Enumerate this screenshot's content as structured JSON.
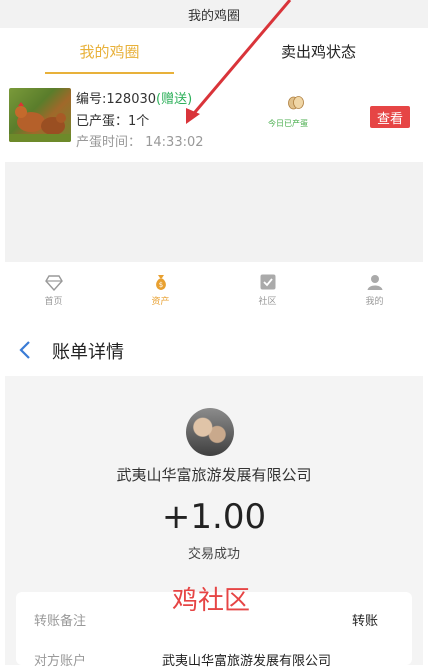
{
  "top": {
    "title": "我的鸡圈",
    "tabs": [
      {
        "label": "我的鸡圈",
        "active": true
      },
      {
        "label": "卖出鸡状态",
        "active": false
      }
    ]
  },
  "chicken_card": {
    "number": "编号:128030",
    "gift": "(赠送)",
    "eggs_laid": "已产蛋：1个",
    "lay_time": "产蛋时间：  14:33:02",
    "today_label": "今日已产蛋",
    "view_button": "查看"
  },
  "bottom_nav": [
    {
      "label": "首页",
      "icon": "diamond-icon",
      "active": false
    },
    {
      "label": "资产",
      "icon": "money-bag-icon",
      "active": true
    },
    {
      "label": "社区",
      "icon": "check-box-icon",
      "active": false
    },
    {
      "label": "我的",
      "icon": "person-icon",
      "active": false
    }
  ],
  "bill": {
    "title": "账单详情",
    "company": "武夷山华富旅游发展有限公司",
    "amount": "+1.00",
    "status": "交易成功",
    "watermark": "鸡社区",
    "rows": [
      {
        "label": "转账备注",
        "value": "转账"
      },
      {
        "label": "对方账户",
        "value": "武夷山华富旅游发展有限公司"
      }
    ]
  },
  "colors": {
    "accent": "#e8b13a",
    "red": "#e64545",
    "green": "#2db05a"
  }
}
